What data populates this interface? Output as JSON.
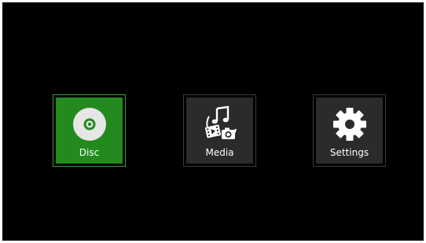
{
  "menu": {
    "items": [
      {
        "label": "Disc",
        "icon": "disc-icon",
        "selected": true
      },
      {
        "label": "Media",
        "icon": "media-icon",
        "selected": false
      },
      {
        "label": "Settings",
        "icon": "gear-icon",
        "selected": false
      }
    ]
  },
  "colors": {
    "background": "#000000",
    "tile": "#2b2b2b",
    "selected_tile": "#238a1d",
    "selected_border": "#3f9b3a",
    "icon": "#ffffff"
  }
}
